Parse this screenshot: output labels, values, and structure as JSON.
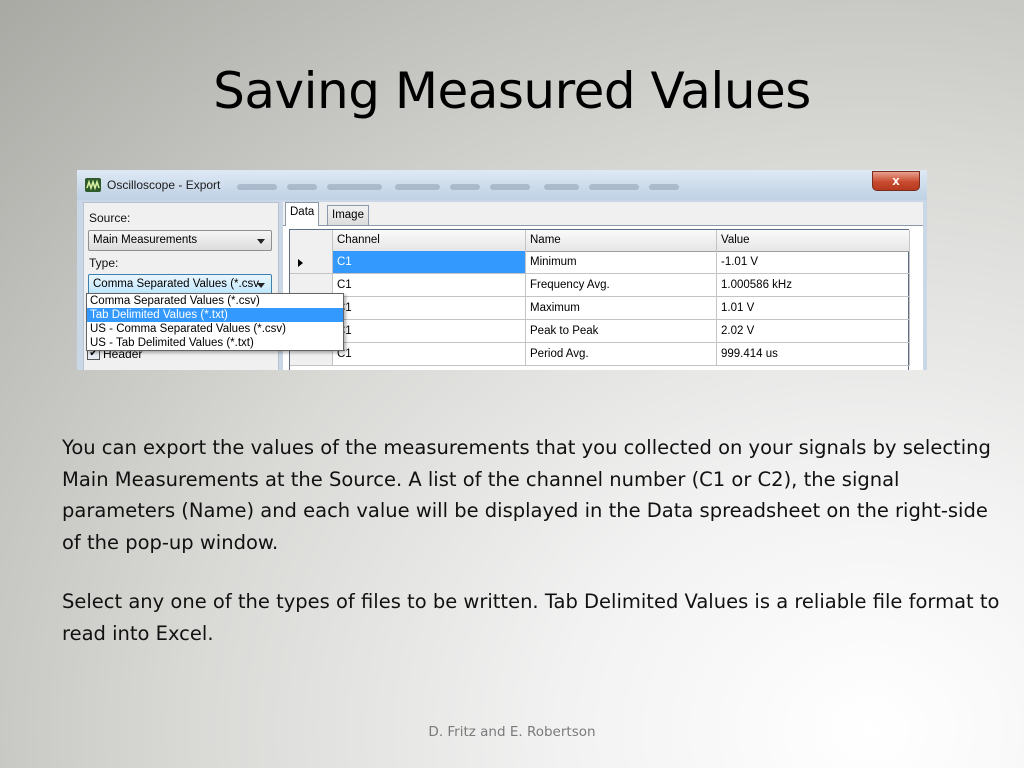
{
  "slide": {
    "title": "Saving Measured Values",
    "paragraph_1": "You can export the values of the measurements that you collected on your signals by selecting Main Measurements at the Source.  A list of the channel number (C1 or C2), the signal parameters (Name) and each value will be displayed in the Data spreadsheet on the right-side of the pop-up window.",
    "paragraph_2": "Select any one of the types of files to be written. Tab Delimited Values is a reliable file format to read into Excel.",
    "footer": "D. Fritz and E. Robertson"
  },
  "window": {
    "title": "Oscilloscope - Export",
    "close_label": "x",
    "source_label": "Source:",
    "source_value": "Main Measurements",
    "type_label": "Type:",
    "type_value": "Comma Separated Values (*.csv",
    "type_options": [
      "Comma Separated Values (*.csv)",
      "Tab Delimited Values (*.txt)",
      "US - Comma Separated Values (*.csv)",
      "US - Tab Delimited Values (*.txt)"
    ],
    "selected_option_index": 1,
    "header_checkbox_label": "Header",
    "header_checked": true,
    "tabs": [
      "Data",
      "Image"
    ],
    "active_tab": "Data",
    "grid": {
      "columns": [
        "Channel",
        "Name",
        "Value"
      ],
      "rows": [
        {
          "channel": "C1",
          "name": "Minimum",
          "value": "-1.01 V"
        },
        {
          "channel": "C1",
          "name": "Frequency Avg.",
          "value": "1.000586 kHz"
        },
        {
          "channel": "C1",
          "name": "Maximum",
          "value": "1.01 V"
        },
        {
          "channel": "C1",
          "name": "Peak to Peak",
          "value": "2.02 V"
        },
        {
          "channel": "C1",
          "name": "Period Avg.",
          "value": "999.414 us"
        }
      ]
    }
  },
  "colors": {
    "selection": "#3399ff",
    "close_button": "#c84a2e",
    "window_frame": "#c9d7e6"
  }
}
